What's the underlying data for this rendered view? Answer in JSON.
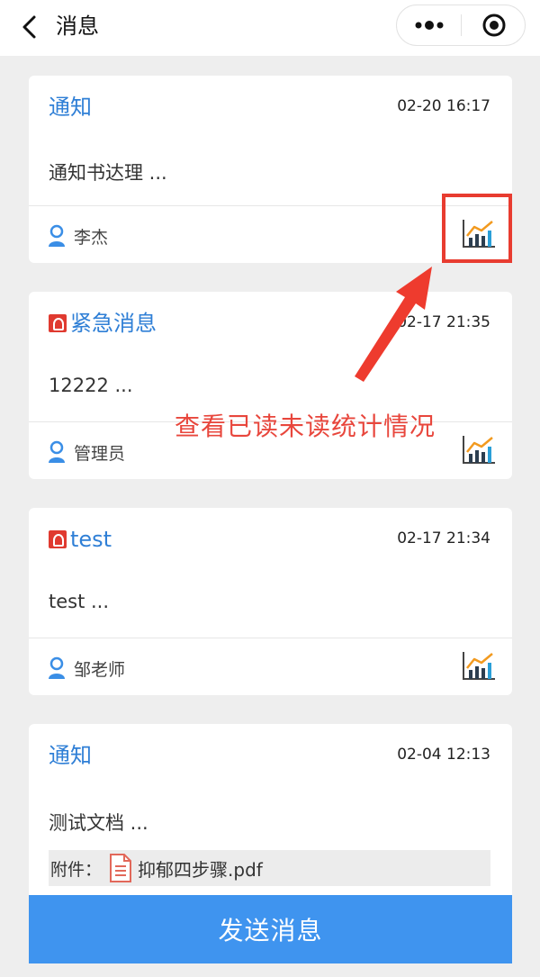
{
  "header": {
    "title": "消息"
  },
  "messages": [
    {
      "tag": "通知",
      "urgent": false,
      "time": "02-20 16:17",
      "summary": "通知书达理 ...",
      "sender": "李杰"
    },
    {
      "tag": "紧急消息",
      "urgent": true,
      "time": "02-17 21:35",
      "summary": "12222 ...",
      "sender": "管理员"
    },
    {
      "tag": "test",
      "urgent": true,
      "time": "02-17 21:34",
      "summary": "test ...",
      "sender": "邹老师"
    },
    {
      "tag": "通知",
      "urgent": false,
      "time": "02-04 12:13",
      "summary": "测试文档 ...",
      "attachment_label": "附件：",
      "attachment_name": "抑郁四步骤.pdf"
    }
  ],
  "annotation": {
    "text": "查看已读未读统计情况"
  },
  "footer": {
    "send_label": "发送消息"
  },
  "colors": {
    "tag_blue": "#2f7fd6",
    "urgent_red": "#e03a30",
    "annotation_red": "#e8463c",
    "send_blue": "#3f94ef"
  }
}
